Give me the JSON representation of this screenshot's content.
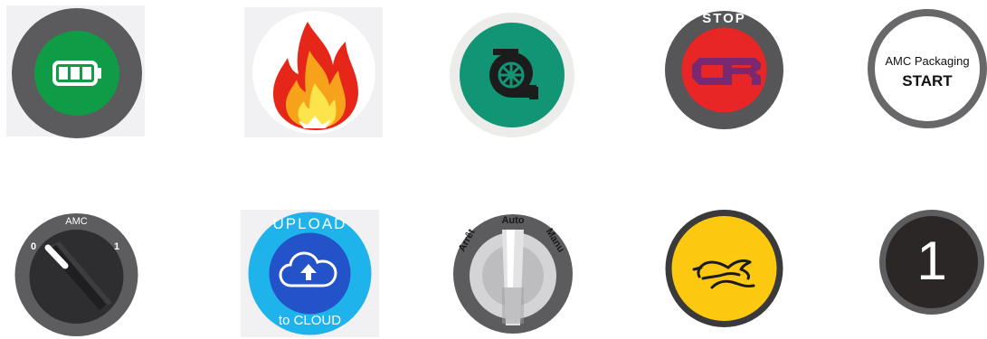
{
  "buttons": [
    {
      "id": "battery",
      "icon": "battery-icon",
      "colors": {
        "ring": "#5b5a5c",
        "face": "#109c46"
      }
    },
    {
      "id": "fire",
      "icon": "flame-icon",
      "colors": {
        "outer": "#e62619",
        "mid": "#f6a21a",
        "inner": "#fde44b"
      }
    },
    {
      "id": "turbo",
      "icon": "turbine-icon",
      "colors": {
        "ring": "#ececea",
        "face": "#129574"
      }
    },
    {
      "id": "stop",
      "label": "STOP",
      "icon": "cr-logo-icon",
      "colors": {
        "ring": "#565557",
        "face": "#e92626",
        "logo": "#7a2870"
      }
    },
    {
      "id": "start",
      "caption": "AMC Packaging",
      "label": "START",
      "colors": {
        "ring": "#686769"
      }
    },
    {
      "id": "amc-selector",
      "label": "AMC",
      "left_mark": "0",
      "right_mark": "1",
      "colors": {
        "ring": "#5d5c5e",
        "face": "#2e2d2f"
      }
    },
    {
      "id": "upload",
      "top_text": "UPLOAD",
      "bottom_text": "to CLOUD",
      "icon": "cloud-upload-icon",
      "colors": {
        "ring": "#1fb3eb",
        "face": "#2452c9"
      }
    },
    {
      "id": "mode-selector",
      "left_label": "Arrêt",
      "center_label": "Auto",
      "right_label": "Manu",
      "colors": {
        "ring": "#5c5b5d",
        "face": "#d4d4d6"
      }
    },
    {
      "id": "fast",
      "icon": "rabbit-icon",
      "colors": {
        "ring": "#3a393b",
        "face": "#fcc810"
      }
    },
    {
      "id": "one",
      "label": "1",
      "colors": {
        "ring": "#5d5c5e",
        "face": "#2b2727"
      }
    }
  ]
}
